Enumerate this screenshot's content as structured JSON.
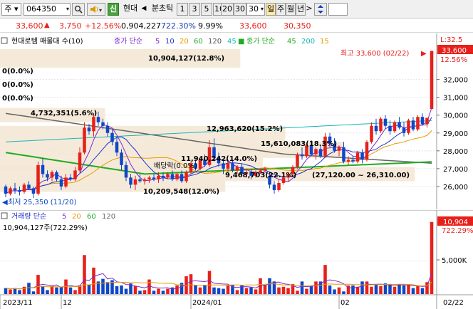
{
  "toolbar": {
    "market": "주",
    "code": "064350",
    "search_icon": "magnifier-icon",
    "speaker_icon": "speaker-icon",
    "credit_badge": "신",
    "company": "현대",
    "prev_arrow": "◀",
    "period_label": "분초틱",
    "periods": [
      "1",
      "3",
      "5",
      "10",
      "20",
      "30"
    ],
    "interval_value": "30",
    "day": "일",
    "week": "주",
    "month": "월",
    "year": "년",
    "next_arrow": ">",
    "updown_icon": "updown-arrows-icon"
  },
  "quote": {
    "price": "33,600",
    "change_arrow": "▲",
    "change": "3,750",
    "change_rate": "+12.56%",
    "volume": "0,904,227",
    "volume_ratio": "722.30%",
    "turnover_pct": "9.99%",
    "high": "33,600",
    "low": "30,350"
  },
  "price_panel": {
    "name": "현대로템 매물대 수(10)",
    "ma_title": "종가 단순",
    "ma_periods": [
      "5",
      "10",
      "20",
      "60",
      "120",
      "45"
    ],
    "ma2_title": "종가 단순",
    "ma2_periods": [
      "45",
      "200",
      "15"
    ],
    "zero_rows": [
      "0(0.0%)",
      "0(0.0%)",
      "0(0.0%)"
    ],
    "overlay_labels": [
      "10,904,127(12.8%)",
      "4,732,351(5.6%)",
      "12,963,620(15.2%)",
      "15,610,083(18.3%)",
      "11,940,242(14.0%)",
      "10,209,548(12.0%)",
      "9,468,703(22.1%)"
    ],
    "range_label": "(27,120.00 ~ 26,310.00)",
    "dividend": "배당락(0.0%)",
    "high_note": "최고 33,600 (02/22)",
    "low_note": "최저 25,350 (11/20)",
    "corner_label": "L:32.5",
    "last_badge": "33,600",
    "last_pct": "12.56%",
    "y_ticks": [
      "32,000",
      "31,000",
      "30,000",
      "29,000",
      "28,000",
      "27,000",
      "26,000"
    ]
  },
  "volume_panel": {
    "name": "거래량 단순",
    "ma_periods": [
      "5",
      "20",
      "60",
      "120"
    ],
    "value_label": "10,904,127주(722.29%)",
    "last_badge": "10,904",
    "last_pct": "722.29%",
    "y_tick": "5,000K"
  },
  "x_labels": [
    "2023/11",
    "12",
    "2024/01",
    "02",
    "02/22"
  ],
  "colors": {
    "up": "#e8201a",
    "down": "#1047c6",
    "ma5": "#7b2bd0",
    "ma10": "#2233cc",
    "ma20": "#e89b00",
    "ma60": "#22aa22",
    "ma120": "#666666",
    "ma45": "#18b5b5",
    "zone": "#f3e6d3"
  },
  "chart_data": {
    "type": "candlestick",
    "candles": [
      [
        26000,
        26100,
        25400,
        25600
      ],
      [
        25600,
        26000,
        25500,
        25900
      ],
      [
        25900,
        26200,
        25600,
        25800
      ],
      [
        25800,
        26000,
        25500,
        25700
      ],
      [
        25700,
        26200,
        25600,
        26100
      ],
      [
        26100,
        26300,
        25800,
        25900
      ],
      [
        25900,
        26000,
        25350,
        25600
      ],
      [
        25600,
        27400,
        25500,
        27200
      ],
      [
        27200,
        27600,
        26500,
        26700
      ],
      [
        26700,
        26900,
        26300,
        26500
      ],
      [
        26500,
        26900,
        26300,
        26800
      ],
      [
        26800,
        26900,
        26300,
        26400
      ],
      [
        26400,
        26600,
        25800,
        26000
      ],
      [
        26000,
        26700,
        25900,
        26500
      ],
      [
        26500,
        26700,
        26300,
        26400
      ],
      [
        26400,
        27100,
        26300,
        26900
      ],
      [
        26900,
        28200,
        26800,
        27900
      ],
      [
        27900,
        29600,
        27800,
        29300
      ],
      [
        29300,
        29500,
        28900,
        29100
      ],
      [
        29100,
        30100,
        28800,
        29900
      ],
      [
        29900,
        30200,
        29400,
        29600
      ],
      [
        29600,
        29800,
        29200,
        29400
      ],
      [
        29400,
        29600,
        28800,
        29000
      ],
      [
        29000,
        29200,
        28300,
        28500
      ],
      [
        28500,
        28800,
        27700,
        27900
      ],
      [
        27900,
        28100,
        26900,
        27200
      ],
      [
        27200,
        27400,
        26300,
        26500
      ],
      [
        26500,
        26700,
        25900,
        26100
      ],
      [
        26100,
        26600,
        25800,
        26400
      ],
      [
        26400,
        26700,
        26200,
        26300
      ],
      [
        26300,
        26500,
        26100,
        26400
      ],
      [
        26400,
        26600,
        26200,
        26500
      ],
      [
        26500,
        26700,
        26300,
        26400
      ],
      [
        26400,
        26800,
        26200,
        26600
      ],
      [
        26600,
        26800,
        26300,
        26500
      ],
      [
        26500,
        26800,
        26400,
        26700
      ],
      [
        26700,
        26900,
        26300,
        26400
      ],
      [
        26400,
        26800,
        26300,
        26700
      ],
      [
        26700,
        26900,
        26200,
        26300
      ],
      [
        26300,
        26900,
        26200,
        26800
      ],
      [
        26800,
        27400,
        26700,
        27300
      ],
      [
        27300,
        27500,
        26900,
        27000
      ],
      [
        27000,
        27600,
        26900,
        27500
      ],
      [
        27500,
        27800,
        27100,
        27200
      ],
      [
        27200,
        28600,
        27100,
        28200
      ],
      [
        28200,
        28700,
        27400,
        27600
      ],
      [
        27600,
        27900,
        27100,
        27300
      ],
      [
        27300,
        27500,
        26700,
        27000
      ],
      [
        27000,
        27400,
        26800,
        27300
      ],
      [
        27300,
        27500,
        26800,
        26900
      ],
      [
        26900,
        27200,
        26700,
        27100
      ],
      [
        27100,
        27300,
        26600,
        26700
      ],
      [
        26700,
        27000,
        26500,
        26800
      ],
      [
        26800,
        27000,
        26400,
        26600
      ],
      [
        26600,
        26900,
        26500,
        26800
      ],
      [
        26800,
        27000,
        26700,
        26900
      ],
      [
        26900,
        27100,
        26800,
        27000
      ],
      [
        26600,
        26800,
        25900,
        26100
      ],
      [
        26100,
        26300,
        25600,
        25800
      ],
      [
        25800,
        26400,
        25700,
        26200
      ],
      [
        26200,
        26600,
        26100,
        26500
      ],
      [
        26500,
        26800,
        26300,
        26700
      ],
      [
        26700,
        27200,
        26600,
        27100
      ],
      [
        27100,
        27900,
        27000,
        27800
      ],
      [
        27800,
        28200,
        27500,
        27700
      ],
      [
        27700,
        28400,
        27600,
        28300
      ],
      [
        28300,
        28600,
        27700,
        27800
      ],
      [
        27800,
        28200,
        27500,
        28100
      ],
      [
        28100,
        28300,
        27600,
        27700
      ],
      [
        27700,
        29000,
        27600,
        28800
      ],
      [
        28800,
        29000,
        28200,
        28400
      ],
      [
        28400,
        28700,
        27900,
        28000
      ],
      [
        28000,
        28300,
        27700,
        28200
      ],
      [
        28200,
        28500,
        27300,
        27400
      ],
      [
        27400,
        27700,
        27200,
        27500
      ],
      [
        27500,
        27700,
        27300,
        27400
      ],
      [
        27400,
        28000,
        27300,
        27900
      ],
      [
        27900,
        28100,
        27300,
        27500
      ],
      [
        27500,
        28600,
        27400,
        28500
      ],
      [
        28500,
        29600,
        28400,
        29400
      ],
      [
        29400,
        29800,
        28900,
        29100
      ],
      [
        29100,
        29900,
        29000,
        29800
      ],
      [
        29800,
        30000,
        29200,
        29400
      ],
      [
        29400,
        29700,
        28900,
        29100
      ],
      [
        29100,
        29700,
        29000,
        29600
      ],
      [
        29600,
        29900,
        29200,
        29300
      ],
      [
        29300,
        29600,
        28800,
        29000
      ],
      [
        29000,
        29800,
        28900,
        29700
      ],
      [
        29700,
        29900,
        29100,
        29200
      ],
      [
        29200,
        30000,
        29100,
        29900
      ],
      [
        29900,
        30100,
        29400,
        29500
      ],
      [
        29500,
        29700,
        29300,
        29850
      ],
      [
        30350,
        33600,
        30350,
        33600
      ]
    ],
    "volume": [
      0.9,
      0.7,
      0.9,
      0.6,
      1.1,
      1.7,
      0.4,
      2.9,
      1.2,
      0.6,
      1.2,
      1.0,
      1.0,
      2.2,
      1.0,
      0.6,
      1.3,
      5.9,
      1.4,
      4.0,
      1.9,
      2.3,
      1.8,
      2.1,
      1.2,
      1.3,
      0.8,
      1.6,
      1.2,
      0.5,
      0.6,
      2.2,
      0.5,
      0.8,
      0.5,
      0.8,
      1.0,
      1.3,
      1.7,
      2.7,
      3.0,
      1.3,
      1.0,
      1.4,
      3.5,
      1.0,
      0.9,
      0.8,
      1.3,
      1.4,
      0.6,
      1.4,
      0.9,
      1.0,
      0.7,
      2.4,
      1.4,
      2.4,
      1.9,
      1.0,
      1.1,
      0.9,
      1.5,
      0.5,
      1.9,
      0.8,
      1.2,
      1.9,
      1.9,
      4.4,
      1.3,
      0.7,
      1.0,
      0.4,
      1.3,
      1.3,
      1.1,
      1.9,
      1.9,
      1.1,
      1.4,
      1.2,
      1.6,
      1.5,
      1.1,
      1.5,
      1.3,
      1.4,
      0.9,
      1.2,
      0.9,
      1.8,
      10.904
    ],
    "volume_unit": "millions of shares",
    "price_range": [
      25000,
      33700
    ],
    "volume_range": [
      0,
      11.2
    ],
    "profile_zones": [
      {
        "low": 32650,
        "high": 33700,
        "volume": 10904127,
        "pct": 12.8
      },
      {
        "low": 29600,
        "high": 30400,
        "volume": 4732351,
        "pct": 5.6
      },
      {
        "low": 28500,
        "high": 29400,
        "volume": 12963620,
        "pct": 15.2
      },
      {
        "low": 27600,
        "high": 28500,
        "volume": 15610083,
        "pct": 18.3
      },
      {
        "low": 26900,
        "high": 27600,
        "volume": 11940242,
        "pct": 14.0
      },
      {
        "low": 26300,
        "high": 27100,
        "volume": 9468703,
        "pct": 22.1
      },
      {
        "low": 25700,
        "high": 26300,
        "volume": 10209548,
        "pct": 12.0
      }
    ],
    "grid": true,
    "legend": "top-left"
  }
}
